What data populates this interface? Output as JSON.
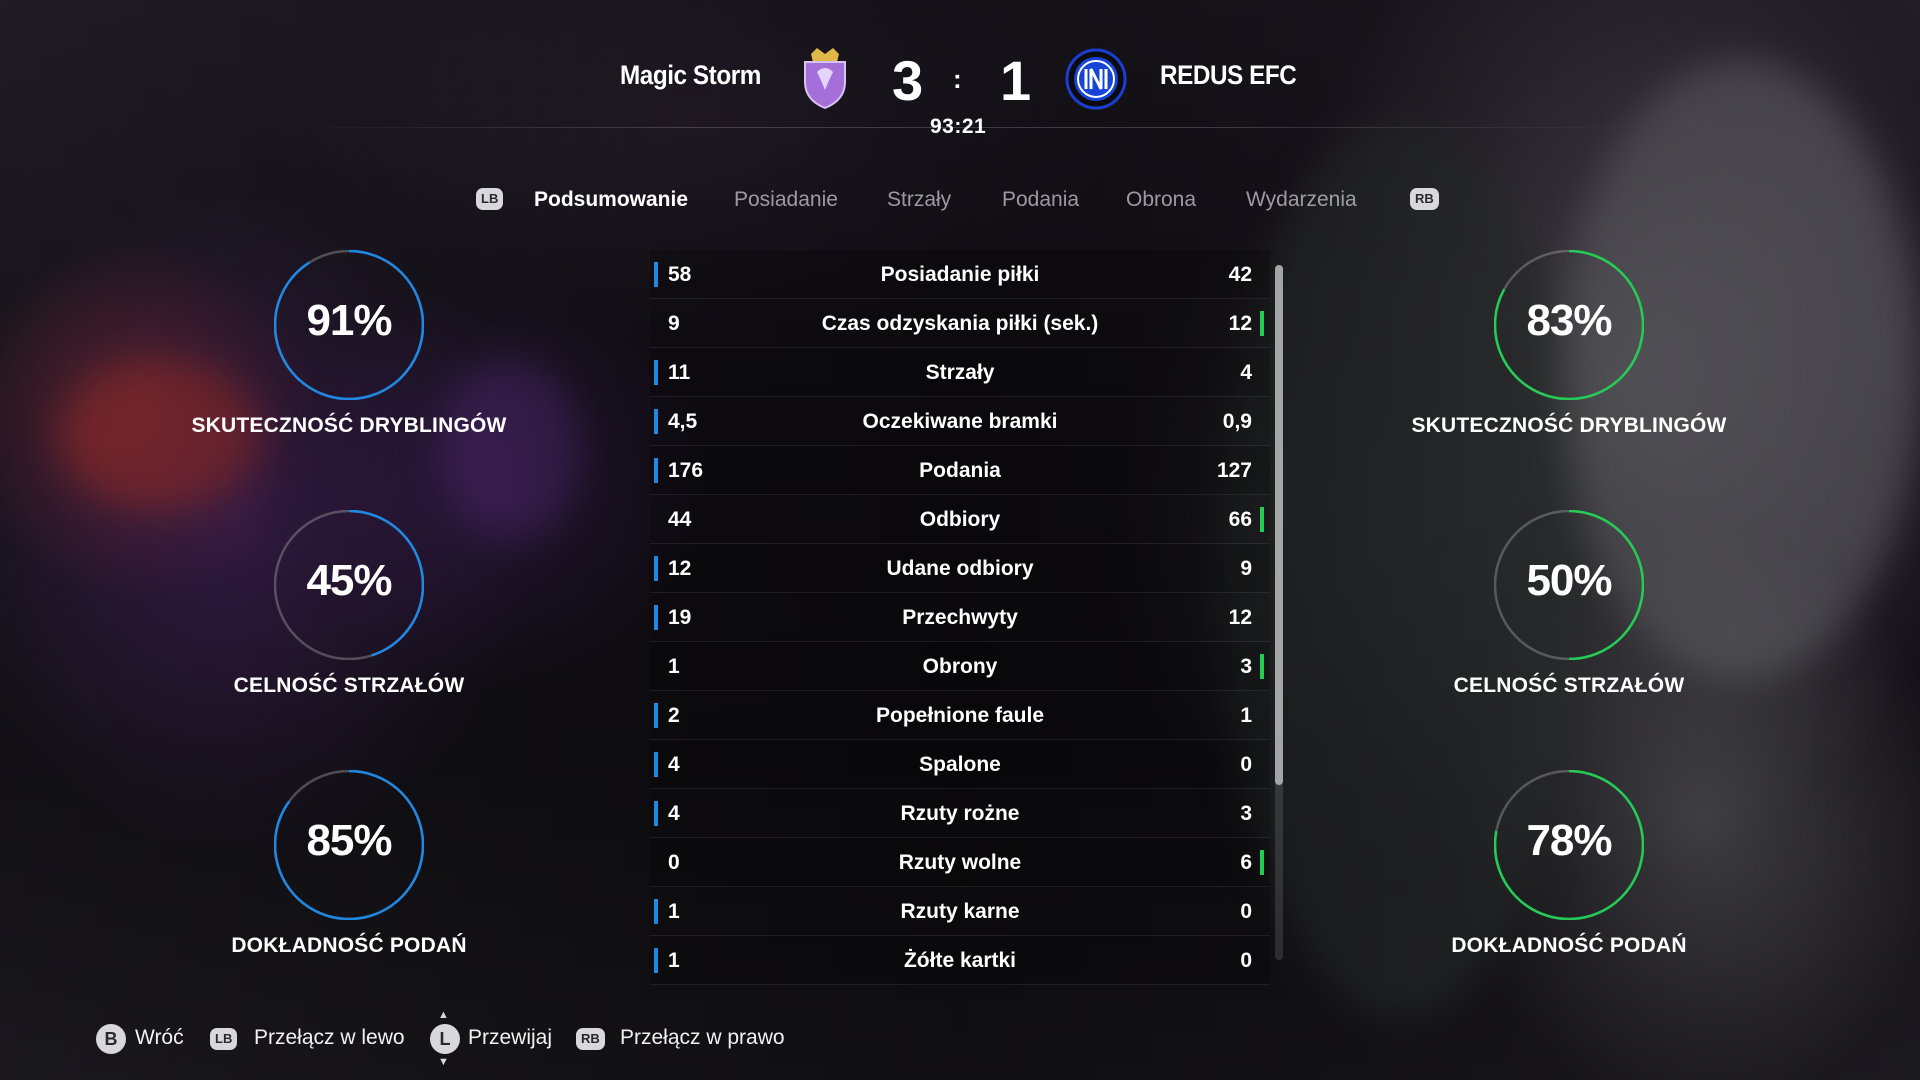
{
  "match": {
    "home_team": "Magic Storm",
    "away_team": "REDUS EFC",
    "home_score": "3",
    "away_score": "1",
    "separator": ":",
    "clock": "93:21",
    "home_color": "#1e88e5",
    "away_color": "#22cc55"
  },
  "tabs": {
    "left_button": "LB",
    "right_button": "RB",
    "items": [
      {
        "label": "Podsumowanie",
        "active": true
      },
      {
        "label": "Posiadanie",
        "active": false
      },
      {
        "label": "Strzały",
        "active": false
      },
      {
        "label": "Podania",
        "active": false
      },
      {
        "label": "Obrona",
        "active": false
      },
      {
        "label": "Wydarzenia",
        "active": false
      }
    ]
  },
  "home_gauges": [
    {
      "value": "91%",
      "percent": 91,
      "label": "SKUTECZNOŚĆ DRYBLINGÓW"
    },
    {
      "value": "45%",
      "percent": 45,
      "label": "CELNOŚĆ STRZAŁÓW"
    },
    {
      "value": "85%",
      "percent": 85,
      "label": "DOKŁADNOŚĆ PODAŃ"
    }
  ],
  "away_gauges": [
    {
      "value": "83%",
      "percent": 83,
      "label": "SKUTECZNOŚĆ DRYBLINGÓW"
    },
    {
      "value": "50%",
      "percent": 50,
      "label": "CELNOŚĆ STRZAŁÓW"
    },
    {
      "value": "78%",
      "percent": 78,
      "label": "DOKŁADNOŚĆ PODAŃ"
    }
  ],
  "stats": [
    {
      "home": "58",
      "label": "Posiadanie piłki",
      "away": "42",
      "leader": "home"
    },
    {
      "home": "9",
      "label": "Czas odzyskania piłki (sek.)",
      "away": "12",
      "leader": "away"
    },
    {
      "home": "11",
      "label": "Strzały",
      "away": "4",
      "leader": "home"
    },
    {
      "home": "4,5",
      "label": "Oczekiwane bramki",
      "away": "0,9",
      "leader": "home"
    },
    {
      "home": "176",
      "label": "Podania",
      "away": "127",
      "leader": "home"
    },
    {
      "home": "44",
      "label": "Odbiory",
      "away": "66",
      "leader": "away"
    },
    {
      "home": "12",
      "label": "Udane odbiory",
      "away": "9",
      "leader": "home"
    },
    {
      "home": "19",
      "label": "Przechwyty",
      "away": "12",
      "leader": "home"
    },
    {
      "home": "1",
      "label": "Obrony",
      "away": "3",
      "leader": "away"
    },
    {
      "home": "2",
      "label": "Popełnione faule",
      "away": "1",
      "leader": "home"
    },
    {
      "home": "4",
      "label": "Spalone",
      "away": "0",
      "leader": "home"
    },
    {
      "home": "4",
      "label": "Rzuty rożne",
      "away": "3",
      "leader": "home"
    },
    {
      "home": "0",
      "label": "Rzuty wolne",
      "away": "6",
      "leader": "away"
    },
    {
      "home": "1",
      "label": "Rzuty karne",
      "away": "0",
      "leader": "home"
    },
    {
      "home": "1",
      "label": "Żółte kartki",
      "away": "0",
      "leader": "home"
    }
  ],
  "footer": {
    "back_button": "B",
    "back_label": "Wróć",
    "lb_button": "LB",
    "lb_label": "Przełącz w lewo",
    "l_button": "L",
    "l_label": "Przewijaj",
    "rb_button": "RB",
    "rb_label": "Przełącz w prawo"
  },
  "icons": {
    "home_crest": "purple-crown-shield-crest-icon",
    "away_crest": "blue-circle-monogram-crest-icon"
  }
}
